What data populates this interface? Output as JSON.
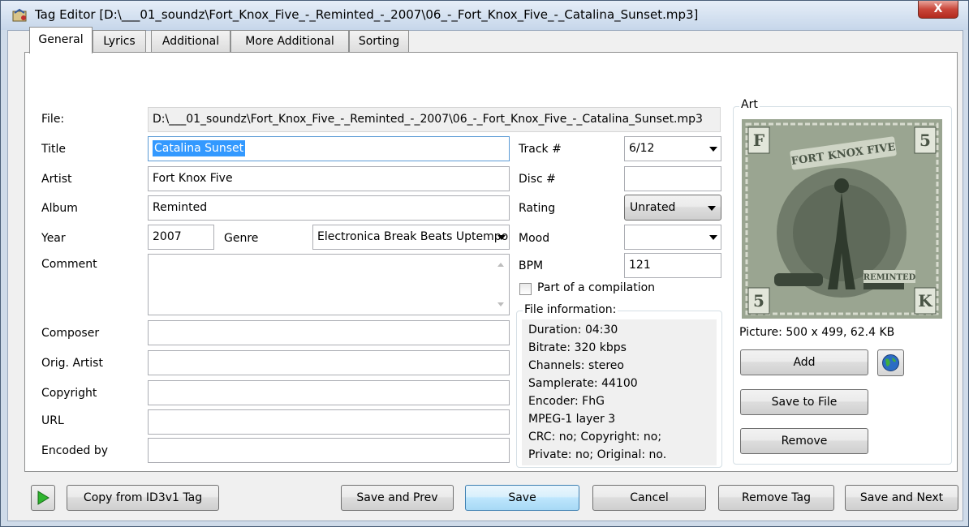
{
  "window": {
    "title": "Tag Editor [D:\\___01_soundz\\Fort_Knox_Five_-_Reminted_-_2007\\06_-_Fort_Knox_Five_-_Catalina_Sunset.mp3]",
    "close_label": "X"
  },
  "tabs": [
    {
      "label": "General",
      "active": true
    },
    {
      "label": "Lyrics",
      "active": false
    },
    {
      "label": "Additional",
      "active": false
    },
    {
      "label": "More Additional",
      "active": false
    },
    {
      "label": "Sorting",
      "active": false
    }
  ],
  "general": {
    "file_label": "File:",
    "file_value": "D:\\___01_soundz\\Fort_Knox_Five_-_Reminted_-_2007\\06_-_Fort_Knox_Five_-_Catalina_Sunset.mp3",
    "title_label": "Title",
    "title_value": "Catalina Sunset",
    "artist_label": "Artist",
    "artist_value": "Fort Knox Five",
    "album_label": "Album",
    "album_value": "Reminted",
    "year_label": "Year",
    "year_value": "2007",
    "genre_label": "Genre",
    "genre_value": "Electronica Break Beats Uptempo",
    "comment_label": "Comment",
    "comment_value": "",
    "composer_label": "Composer",
    "composer_value": "",
    "orig_artist_label": "Orig. Artist",
    "orig_artist_value": "",
    "copyright_label": "Copyright",
    "copyright_value": "",
    "url_label": "URL",
    "url_value": "",
    "encoded_by_label": "Encoded by",
    "encoded_by_value": "",
    "track_label": "Track #",
    "track_value": "6/12",
    "disc_label": "Disc #",
    "disc_value": "",
    "rating_label": "Rating",
    "rating_value": "Unrated",
    "mood_label": "Mood",
    "mood_value": "",
    "bpm_label": "BPM",
    "bpm_value": "121",
    "compilation_label": "Part of a compilation",
    "compilation_checked": false
  },
  "file_info": {
    "title": "File information:",
    "lines": [
      "Duration: 04:30",
      "Bitrate: 320 kbps",
      "Channels: stereo",
      "Samplerate: 44100",
      "Encoder: FhG",
      "MPEG-1 layer 3",
      "CRC: no; Copyright: no;",
      "Private: no; Original: no."
    ]
  },
  "art": {
    "title": "Art",
    "picture_info": "Picture: 500 x 499, 62.4 KB",
    "cover_text_top": "FORT KNOX FIVE",
    "cover_text_bottom": "REMINTED",
    "corner_tl": "F",
    "corner_tr": "5",
    "corner_bl": "5",
    "corner_br": "K",
    "add_label": "Add",
    "save_to_file_label": "Save to File",
    "remove_label": "Remove"
  },
  "footer": {
    "copy_id3v1_label": "Copy from ID3v1 Tag",
    "save_prev_label": "Save and Prev",
    "save_label": "Save",
    "cancel_label": "Cancel",
    "remove_tag_label": "Remove Tag",
    "save_next_label": "Save and Next"
  },
  "colors": {
    "selection": "#3399ff",
    "play_green": "#2fb52f",
    "art_tint": "#8f9a87"
  }
}
